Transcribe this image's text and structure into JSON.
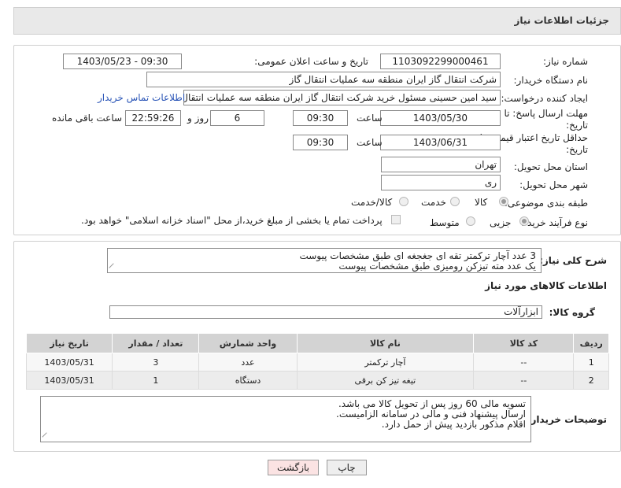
{
  "header": {
    "title": "جزئیات اطلاعات نیاز"
  },
  "need_number": {
    "label": "شماره نیاز:",
    "value": "1103092299000461"
  },
  "announce_date": {
    "label": "تاریخ و ساعت اعلان عمومی:",
    "value": "1403/05/23 - 09:30"
  },
  "buyer_org": {
    "label": "نام دستگاه خریدار:",
    "value": "شرکت انتقال گاز ایران منطقه سه عملیات انتقال گاز"
  },
  "requester": {
    "label": "ایجاد کننده درخواست:",
    "value": "سید امین حسینی مسئول خرید شرکت انتقال گاز ایران منطقه سه عملیات انتقال گاز",
    "contact_link": "اطلاعات تماس خریدار"
  },
  "reply_deadline": {
    "label_line1": "مهلت ارسال پاسخ: تا",
    "label_line2": "تاریخ:",
    "date": "1403/05/30",
    "time_label": "ساعت",
    "time": "09:30",
    "days": "6",
    "days_label": "روز و",
    "remaining": "22:59:26",
    "remaining_label": "ساعت باقی مانده"
  },
  "price_validity": {
    "label_line1": "حداقل تاریخ اعتبار قیمت: تا",
    "label_line2": "تاریخ:",
    "date": "1403/06/31",
    "time_label": "ساعت",
    "time": "09:30"
  },
  "delivery_province": {
    "label": "استان محل تحویل:",
    "value": "تهران"
  },
  "delivery_city": {
    "label": "شهر محل تحویل:",
    "value": "ری"
  },
  "category": {
    "label": "طبقه بندی موضوعی:",
    "options": [
      "کالا",
      "خدمت",
      "کالا/خدمت"
    ],
    "selected": "کالا"
  },
  "purchase_type": {
    "label": "نوع فرآیند خرید :",
    "options": [
      "جزیی",
      "متوسط"
    ],
    "selected": "جزیی",
    "treasury_note": "پرداخت تمام یا بخشی از مبلغ خرید،از محل \"اسناد خزانه اسلامی\" خواهد بود."
  },
  "description": {
    "label": "شرح کلی نیاز:",
    "lines": [
      "3 عدد آچار ترکمتر تقه ای جغجغه ای طبق مشخصات پیوست",
      "یک عدد متە تیزکن رومیزی طبق مشخصات پیوست"
    ]
  },
  "goods_section_title": "اطلاعات کالاهای مورد نیاز",
  "goods_group": {
    "label": "گروه کالا:",
    "value": "ابزارآلات"
  },
  "goods_table": {
    "headers": [
      "ردیف",
      "کد کالا",
      "نام کالا",
      "واحد شمارش",
      "تعداد / مقدار",
      "تاریخ نیاز"
    ],
    "rows": [
      [
        "1",
        "--",
        "آچار ترکمتر",
        "عدد",
        "3",
        "1403/05/31"
      ],
      [
        "2",
        "--",
        "تیغه تیز کن برقی",
        "دستگاه",
        "1",
        "1403/05/31"
      ]
    ]
  },
  "buyer_notes": {
    "label": "توضیحات خریدار:",
    "lines": [
      "تسویه مالی 60 روز پس از تحویل کالا می باشد.",
      "ارسال پیشنهاد فنی و مالی در سامانه الزامیست.",
      "اقلام مذکور بازدید پیش از حمل دارد."
    ]
  },
  "buttons": {
    "print": "چاپ",
    "back": "بازگشت"
  },
  "colors": {
    "link": "#2a55b7",
    "back_button_bg": "#fbe3e3",
    "print_button_bg": "#eeeeee"
  }
}
